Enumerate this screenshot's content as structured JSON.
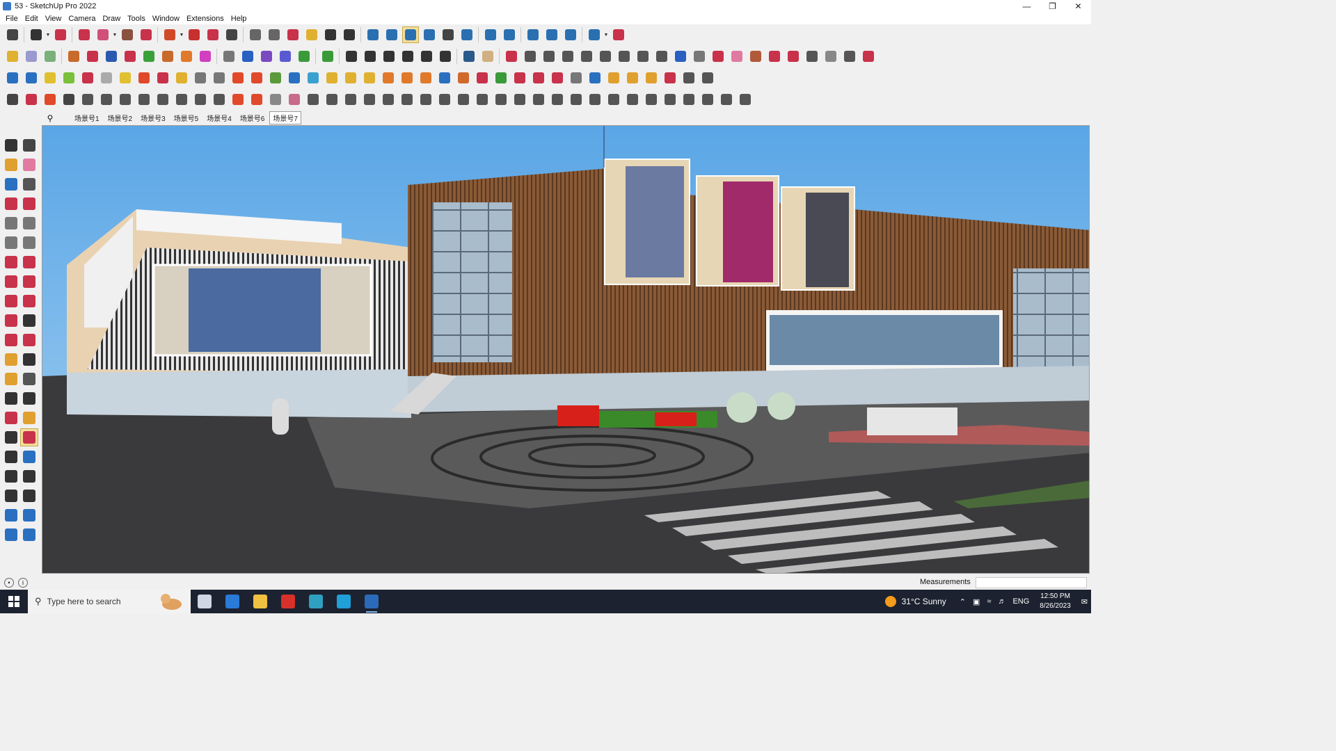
{
  "window": {
    "title": "53 - SketchUp Pro 2022",
    "controls": [
      "minimize",
      "maximize",
      "close"
    ]
  },
  "menu": [
    "File",
    "Edit",
    "View",
    "Camera",
    "Draw",
    "Tools",
    "Window",
    "Extensions",
    "Help"
  ],
  "toolbars": {
    "row1_colors": [
      "#444",
      "#333",
      "#c8324a",
      "#c8324a",
      "#d0507a",
      "#8a5040",
      "#c8324a",
      "#d04a2a",
      "#c83030",
      "#c8324a",
      "#444",
      "#666",
      "#666",
      "#c8324a",
      "#e0b030",
      "#333",
      "#333",
      "#2a70b0",
      "#2a70b0",
      "#2a70b0",
      "#2a70b0",
      "#444",
      "#2a70b0",
      "#2a70b0",
      "#2a70b0",
      "#2a70b0",
      "#2a70b0",
      "#2a70b0",
      "#2a70b0",
      "#c8324a"
    ],
    "row2_colors": [
      "#e0b030",
      "#9a9ad0",
      "#7ab07a",
      "#c86a2a",
      "#c8324a",
      "#2a5ab0",
      "#c8324a",
      "#3aa03a",
      "#c86a2a",
      "#e07a2a",
      "#d040c0",
      "#777",
      "#2a60c0",
      "#7a4ac0",
      "#5a5ad0",
      "#3a9a3a",
      "#3a9a3a",
      "#333",
      "#333",
      "#333",
      "#333",
      "#333",
      "#333",
      "#2a5a8a",
      "#d0b080",
      "#c8324a",
      "#555",
      "#555",
      "#555",
      "#555",
      "#555",
      "#555",
      "#555",
      "#555",
      "#2a60c0",
      "#777",
      "#c8324a",
      "#e07aa0",
      "#b05a3a",
      "#c8324a",
      "#c8324a",
      "#555",
      "#888",
      "#555",
      "#c8324a"
    ],
    "row3_colors": [
      "#2a70c0",
      "#2a70c0",
      "#e0c030",
      "#7ac03a",
      "#c8324a",
      "#aaa",
      "#e0c030",
      "#e04a2a",
      "#c8324a",
      "#e0b030",
      "#777",
      "#777",
      "#e04a2a",
      "#e04a2a",
      "#5a9a3a",
      "#2a70c0",
      "#3aa0d0",
      "#e0b030",
      "#e0b030",
      "#e0b030",
      "#e07a2a",
      "#e07a2a",
      "#e07a2a",
      "#2a70c0",
      "#d06a2a",
      "#c8324a",
      "#3a9a3a",
      "#c8324a",
      "#c8324a",
      "#c8324a",
      "#777",
      "#2a70c0",
      "#e0a030",
      "#e0a030",
      "#e0a030",
      "#c8324a",
      "#555",
      "#555"
    ],
    "row4_colors": [
      "#444",
      "#c8324a",
      "#e04a2a",
      "#444",
      "#555",
      "#555",
      "#555",
      "#555",
      "#555",
      "#555",
      "#555",
      "#555",
      "#e04a2a",
      "#e04a2a",
      "#888",
      "#c86a8a",
      "#555",
      "#555",
      "#555",
      "#555",
      "#555",
      "#555",
      "#555",
      "#555",
      "#555",
      "#555",
      "#555",
      "#555",
      "#555",
      "#555",
      "#555",
      "#555",
      "#555",
      "#555",
      "#555",
      "#555",
      "#555",
      "#555",
      "#555",
      "#555"
    ]
  },
  "scenes": {
    "search_icon": "search-icon",
    "tabs": [
      "场景号1",
      "场景号2",
      "场景号3",
      "场景号5",
      "场景号4",
      "场景号6",
      "场景号7"
    ],
    "selected": "场景号7"
  },
  "left_toolbar": {
    "colors": [
      [
        "#333",
        "#444"
      ],
      [
        "#e0a030",
        "#e07aa0"
      ],
      [
        "#2a70c0",
        "#555"
      ],
      [
        "#c8324a",
        "#c8324a"
      ],
      [
        "#777",
        "#777"
      ],
      [
        "#777",
        "#777"
      ],
      [
        "#c8324a",
        "#c8324a"
      ],
      [
        "#c8324a",
        "#c8324a"
      ],
      [
        "#c8324a",
        "#c8324a"
      ],
      [
        "#c8324a",
        "#333"
      ],
      [
        "#c8324a",
        "#c8324a"
      ],
      [
        "#e0a030",
        "#333"
      ],
      [
        "#e0a030",
        "#555"
      ],
      [
        "#333",
        "#333"
      ],
      [
        "#c8324a",
        "#e0a030"
      ],
      [
        "#333",
        "#c8324a"
      ],
      [
        "#333",
        "#2a70c0"
      ],
      [
        "#333",
        "#333"
      ],
      [
        "#333",
        "#333"
      ],
      [
        "#2a70c0",
        "#2a70c0"
      ],
      [
        "#2a70c0",
        "#2a70c0"
      ]
    ]
  },
  "status": {
    "measurements_label": "Measurements",
    "measurements_value": ""
  },
  "taskbar": {
    "search_placeholder": "Type here to search",
    "apps": [
      {
        "name": "task-view",
        "color": "#cfd6e4"
      },
      {
        "name": "calculator",
        "color": "#2a7ad8"
      },
      {
        "name": "file-explorer",
        "color": "#f0c040"
      },
      {
        "name": "acrobat",
        "color": "#d8302a"
      },
      {
        "name": "app-3",
        "color": "#30a0c0"
      },
      {
        "name": "edge",
        "color": "#1fa0d8"
      },
      {
        "name": "sketchup",
        "color": "#2a6ab8"
      }
    ],
    "weather": "31°C  Sunny",
    "language": "ENG",
    "time": "12:50 PM",
    "date": "8/26/2023"
  }
}
